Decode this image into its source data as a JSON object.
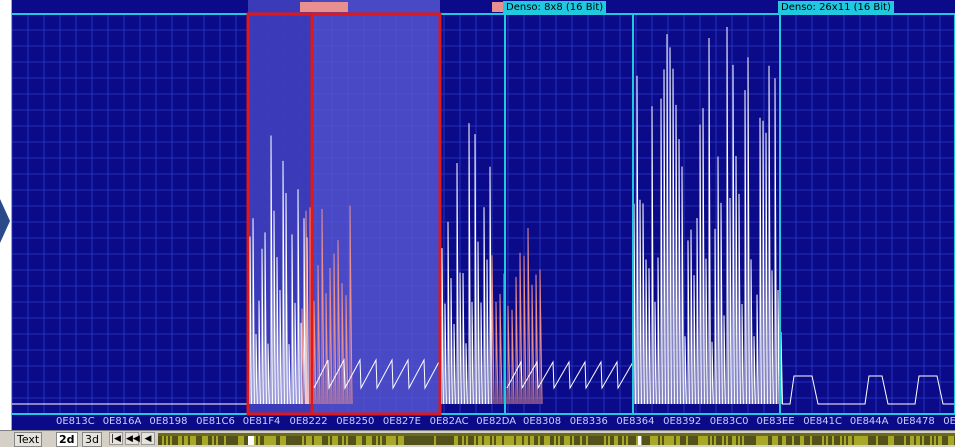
{
  "window": {
    "background": "#0b0b8a",
    "grid_color": "#3344c8",
    "trace_color": "#ffffff"
  },
  "plot": {
    "map_labels": [
      {
        "text": "Denso: 8x8 (16 Bit)"
      },
      {
        "text": "Denso: 26x11 (16 Bit)"
      }
    ],
    "address_labels": [
      "0E813C",
      "0E816A",
      "0E8198",
      "0E81C6",
      "0E81F4",
      "0E8222",
      "0E8250",
      "0E827E",
      "0E82AC",
      "0E82DA",
      "0E8308",
      "0E8336",
      "0E8364",
      "0E8392",
      "0E83C0",
      "0E83EE",
      "0E841C",
      "0E844A",
      "0E8478",
      "0E84"
    ]
  },
  "bottom_bar": {
    "tabs": [
      "Text",
      "2d",
      "3d"
    ],
    "nav_buttons": [
      "|◀",
      "◀◀",
      "◀"
    ]
  },
  "colors": {
    "selection_border": "#e01818",
    "selection_fill": "#5555d0",
    "map_border": "#20c8e0",
    "map_label_bg": "#20c8e0",
    "marker_pink": "#e89090"
  }
}
